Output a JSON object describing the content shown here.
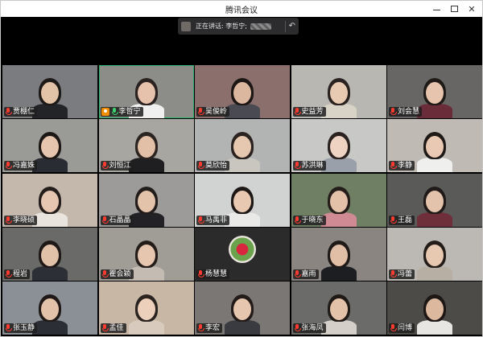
{
  "window": {
    "title": "腾讯会议"
  },
  "speaker": {
    "label": "正在讲话: 李哲宁;"
  },
  "participants": [
    {
      "name": "贾棚仁",
      "bg": "#7a7c80",
      "skin": "#e3c3a8",
      "hair": "#1e1a18",
      "shirt": "#222428",
      "mic": "muted",
      "host": false
    },
    {
      "name": "李哲宁",
      "bg": "#8c8c88",
      "skin": "#e6c2ac",
      "hair": "#2a2220",
      "shirt": "#f0f0f0",
      "mic": "on",
      "host": true,
      "active": true
    },
    {
      "name": "吴俊岭",
      "bg": "#8a6f6c",
      "skin": "#dcb79f",
      "hair": "#1c1715",
      "shirt": "#4a4b52",
      "mic": "muted",
      "host": false
    },
    {
      "name": "史益芳",
      "bg": "#b9b7b2",
      "skin": "#e8c9b2",
      "hair": "#2a2220",
      "shirt": "#d9d2c6",
      "mic": "muted",
      "host": false
    },
    {
      "name": "刘会慧",
      "bg": "#676664",
      "skin": "#e6c4ad",
      "hair": "#1f1a18",
      "shirt": "#6a2c38",
      "mic": "muted",
      "host": false
    },
    {
      "name": "冯嘉姝",
      "bg": "#9a9a96",
      "skin": "#e5c5ae",
      "hair": "#1d1816",
      "shirt": "#2a2c33",
      "mic": "muted",
      "host": false
    },
    {
      "name": "刘恒江",
      "bg": "#a7a6a1",
      "skin": "#e1c0a7",
      "hair": "#2b2421",
      "shirt": "#1f1f22",
      "mic": "muted",
      "host": false
    },
    {
      "name": "莫欣怡",
      "bg": "#b2b4b4",
      "skin": "#e6c7b0",
      "hair": "#2a221e",
      "shirt": "#c9c6c0",
      "mic": "muted",
      "host": false
    },
    {
      "name": "苏洪琳",
      "bg": "#c8c8c6",
      "skin": "#efd3c2",
      "hair": "#2a221f",
      "shirt": "#9aa0aa",
      "mic": "muted",
      "host": false
    },
    {
      "name": "李静",
      "bg": "#bfbab4",
      "skin": "#e9c9b3",
      "hair": "#1f1917",
      "shirt": "#efefee",
      "mic": "muted",
      "host": false
    },
    {
      "name": "李晓硕",
      "bg": "#c3b8ab",
      "skin": "#e6c6b0",
      "hair": "#241d1b",
      "shirt": "#e9e4dd",
      "mic": "muted",
      "host": false
    },
    {
      "name": "石晶晶",
      "bg": "#9c9b99",
      "skin": "#e4c3ab",
      "hair": "#221c1a",
      "shirt": "#222226",
      "mic": "muted",
      "host": false
    },
    {
      "name": "马禹非",
      "bg": "#d1d3d3",
      "skin": "#e8c8b0",
      "hair": "#1d1816",
      "shirt": "#e9e9e7",
      "mic": "muted",
      "host": false
    },
    {
      "name": "于晓东",
      "bg": "#6f7f64",
      "skin": "#e3c0a8",
      "hair": "#241d1a",
      "shirt": "#d08a94",
      "mic": "muted",
      "host": false
    },
    {
      "name": "王磊",
      "bg": "#5a5a58",
      "skin": "#e4c3ac",
      "hair": "#201a18",
      "shirt": "#6e2f3a",
      "mic": "muted",
      "host": false
    },
    {
      "name": "程岩",
      "bg": "#6a6a68",
      "skin": "#e2c1a9",
      "hair": "#1e1917",
      "shirt": "#2d2f36",
      "mic": "muted",
      "host": false
    },
    {
      "name": "瞿会颖",
      "bg": "#a09c96",
      "skin": "#e6c6ae",
      "hair": "#231c19",
      "shirt": "#c4bcb2",
      "mic": "muted",
      "host": false
    },
    {
      "name": "杨慧慧",
      "bg": "#2b2b2c",
      "avatar": true,
      "mic": "muted",
      "host": false
    },
    {
      "name": "嘉雨",
      "bg": "#8a8580",
      "skin": "#e1bea6",
      "hair": "#1f1917",
      "shirt": "#1d1e22",
      "mic": "muted",
      "host": false
    },
    {
      "name": "冯蕾",
      "bg": "#bcb9b4",
      "skin": "#e7c8b1",
      "hair": "#231c19",
      "shirt": "#b7aea4",
      "mic": "muted",
      "host": false
    },
    {
      "name": "张玉静",
      "bg": "#8b8f96",
      "skin": "#e3c2aa",
      "hair": "#1f1917",
      "shirt": "#2c2e35",
      "mic": "muted",
      "host": false
    },
    {
      "name": "孟佳",
      "bg": "#c8b7a4",
      "skin": "#ecd0bc",
      "hair": "#2b231f",
      "shirt": "#d8cbbd",
      "mic": "muted",
      "host": false
    },
    {
      "name": "李宏",
      "bg": "#7b7775",
      "skin": "#e6c6ae",
      "hair": "#221b19",
      "shirt": "#3a3b40",
      "mic": "muted",
      "host": false
    },
    {
      "name": "张海凤",
      "bg": "#6b6b69",
      "skin": "#e3c2aa",
      "hair": "#201a17",
      "shirt": "#d4cfc8",
      "mic": "muted",
      "host": false
    },
    {
      "name": "闫博",
      "bg": "#4d4b48",
      "skin": "#dcb89e",
      "hair": "#1d1816",
      "shirt": "#e8e6e2",
      "mic": "muted",
      "host": false
    }
  ]
}
